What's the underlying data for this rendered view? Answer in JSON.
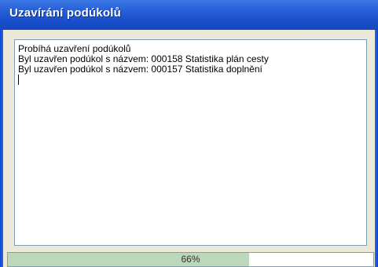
{
  "window": {
    "title": "Uzavírání podúkolů"
  },
  "log": {
    "lines": [
      "Probíhá uzavření podúkolů",
      "Byl uzavřen podúkol s názvem: 000158 Statistika plán cesty",
      "Byl uzavřen podúkol s názvem: 000157 Statistika doplnění"
    ]
  },
  "progress": {
    "percent": 66,
    "label": "66%"
  },
  "colors": {
    "titlebar": "#2a62d8",
    "progress_fill": "#bcd8bc",
    "window_bg": "#ece9d8"
  }
}
